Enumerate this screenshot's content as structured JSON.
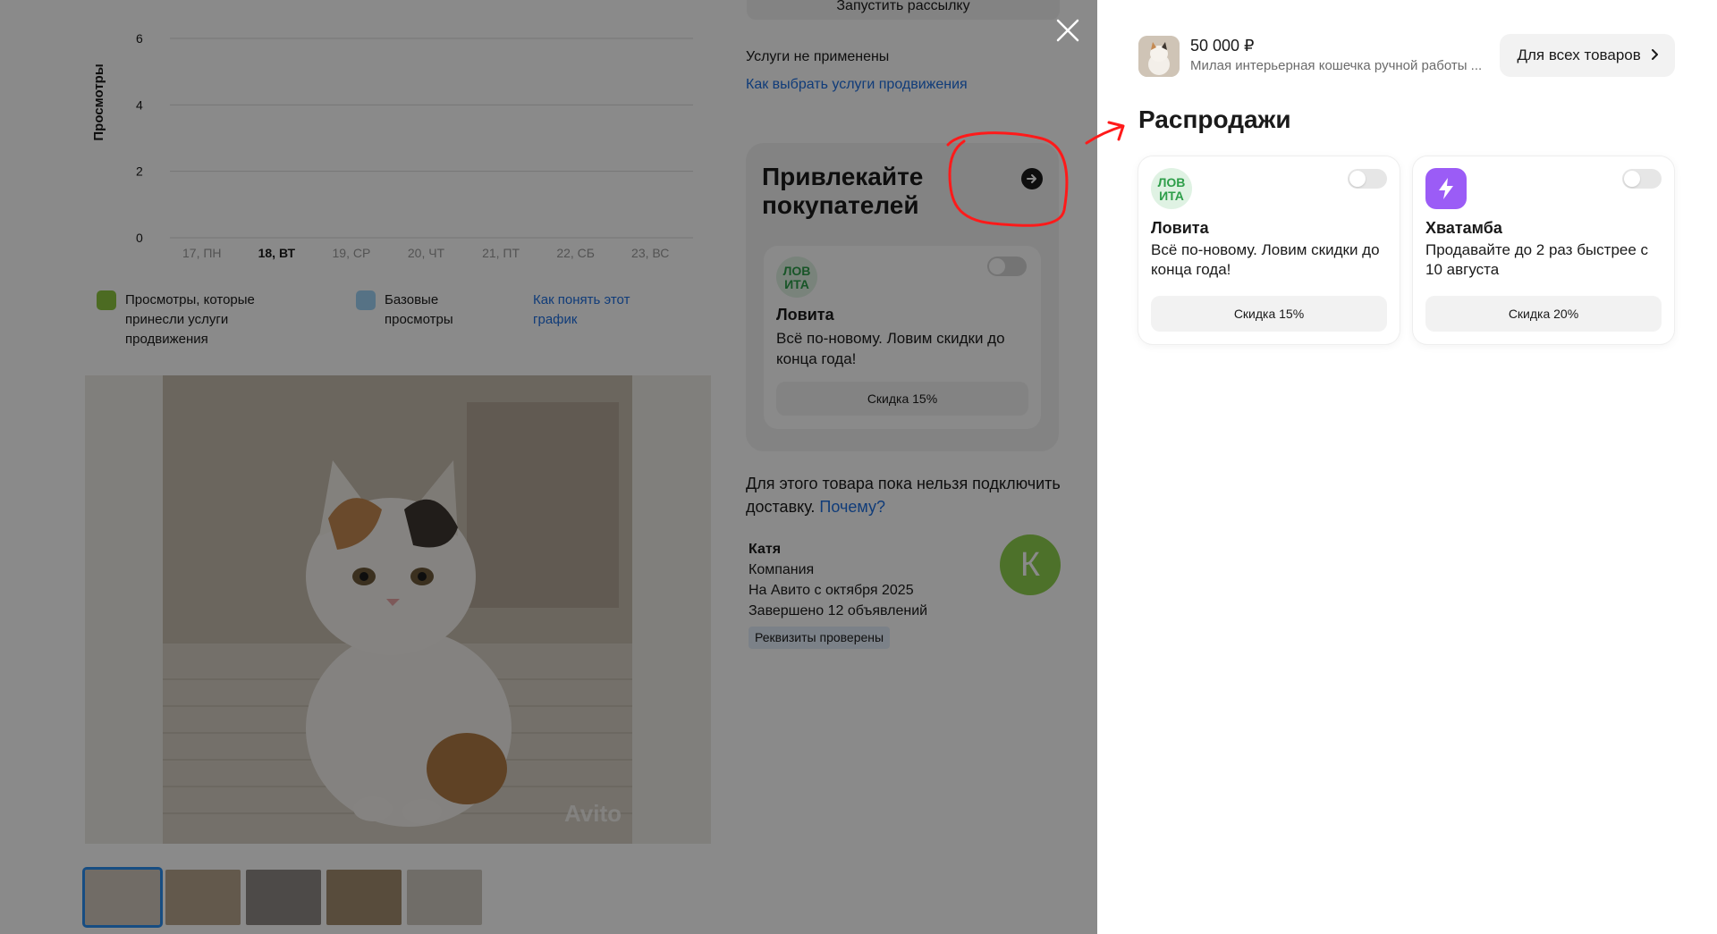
{
  "chart_data": {
    "type": "bar",
    "categories": [
      "17, ПН",
      "18, ВТ",
      "19, СР",
      "20, ЧТ",
      "21, ПТ",
      "22, СБ",
      "23, ВС"
    ],
    "highlighted_category": "18, ВТ",
    "series": [
      {
        "name": "Просмотры, которые принесли услуги продвижения",
        "color": "#8cc63f",
        "values": [
          0,
          0,
          0,
          0,
          0,
          0,
          0
        ]
      },
      {
        "name": "Базовые просмотры",
        "color": "#9fd3f5",
        "values": [
          0,
          0,
          0,
          0,
          0,
          0,
          0
        ]
      }
    ],
    "yticks": [
      "0",
      "2",
      "4",
      "6"
    ],
    "ylabel": "Просмотры",
    "ylim": [
      0,
      6
    ],
    "grid": true
  },
  "legend": {
    "promo_views": "Просмотры, которые принесли услуги продвижения",
    "base_views": "Базовые просмотры",
    "help_link": "Как понять этот график"
  },
  "listing": {
    "photo_watermark": "Avito",
    "thumb_count": 5,
    "top_button": "Запустить рассылку",
    "services_status": "Услуги не применены",
    "services_link": "Как выбрать услуги продвижения",
    "promo_block": {
      "title": "Привлекайте покупателей",
      "card": {
        "name": "Ловита",
        "desc": "Всё по-новому. Ловим скидки до конца года!",
        "button": "Скидка 15%"
      }
    },
    "delivery_text": "Для этого товара пока нельзя подключить доставку.",
    "delivery_link": "Почему?",
    "seller": {
      "name": "Катя",
      "type": "Компания",
      "since": "На Авито с октября 2025",
      "completed": "Завершено 12 объявлений",
      "badge": "Реквизиты проверены",
      "avatar_letter": "К"
    }
  },
  "drawer": {
    "price": "50 000 ₽",
    "product_title": "Милая интерьерная кошечка ручной работы ...",
    "all_goods_button": "Для всех товаров",
    "sales_title": "Распродажи",
    "sales": [
      {
        "name": "Ловита",
        "desc": "Всё по-новому. Ловим скидки до конца года!",
        "button": "Скидка 15%",
        "logo_color": "#2e9e4a",
        "enabled": false
      },
      {
        "name": "Хватамба",
        "desc": "Продавайте до 2 раз быстрее с 10 августа",
        "button": "Скидка 20%",
        "logo_color": "#9b5cf6",
        "enabled": false
      }
    ]
  },
  "colors": {
    "link": "#1f6fe0",
    "annotation": "#ff1a1a",
    "avatar": "#8fd14f"
  },
  "icons": {
    "close": "close-icon",
    "promo_arrow": "arrow-right-circle-icon",
    "chevron": "chevron-right-icon",
    "lightning": "lightning-icon"
  }
}
